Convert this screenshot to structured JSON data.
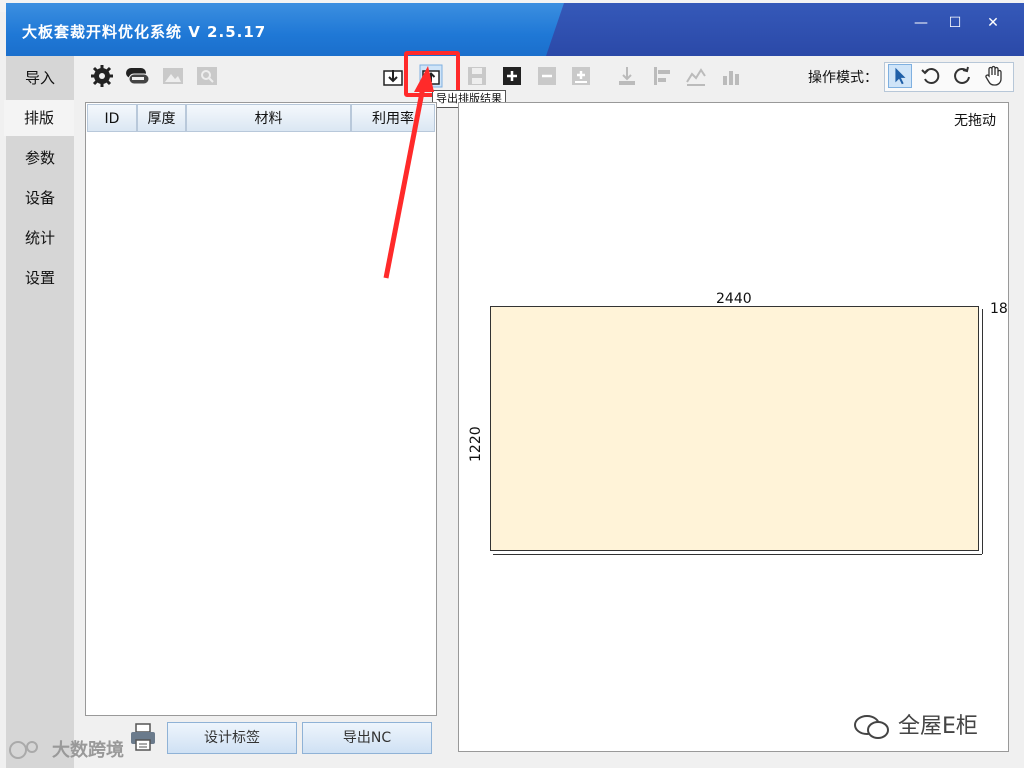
{
  "app": {
    "title": "大板套裁开料优化系统 V 2.5.17"
  },
  "window_controls": {
    "minimize": "—",
    "maximize": "☐",
    "close": "✕"
  },
  "nav": {
    "items": [
      {
        "label": "导入"
      },
      {
        "label": "排版",
        "active": true
      },
      {
        "label": "参数"
      },
      {
        "label": "设备"
      },
      {
        "label": "统计"
      },
      {
        "label": "设置"
      }
    ]
  },
  "toolbar": {
    "icons": [
      "settings-gear-icon",
      "layers-icon",
      "image-icon",
      "image-search-icon",
      "import-layout-icon",
      "export-layout-icon",
      "save-icon",
      "add-icon",
      "remove-icon",
      "add-sheet-icon",
      "align-bottom-icon",
      "align-left-icon",
      "chart-icon",
      "bar-chart-icon"
    ],
    "tooltip": "导出排版结果",
    "mode_label": "操作模式："
  },
  "mode_icons": [
    "select-cursor-icon",
    "rotate-ccw-icon",
    "rotate-cw-icon",
    "pan-hand-icon"
  ],
  "list": {
    "columns": [
      "ID",
      "厚度",
      "材料",
      "利用率"
    ]
  },
  "bottom": {
    "design_label": "设计标签",
    "export_nc": "导出NC"
  },
  "canvas": {
    "drag_status": "无拖动",
    "board_width": "2440",
    "board_height": "1220",
    "board_thickness": "18"
  },
  "watermarks": {
    "right": "全屋E柜",
    "left": "大数跨境"
  },
  "colors": {
    "title_blue": "#1f78d6",
    "highlight_red": "#ff2a2a",
    "board_fill": "#fff3d8"
  }
}
